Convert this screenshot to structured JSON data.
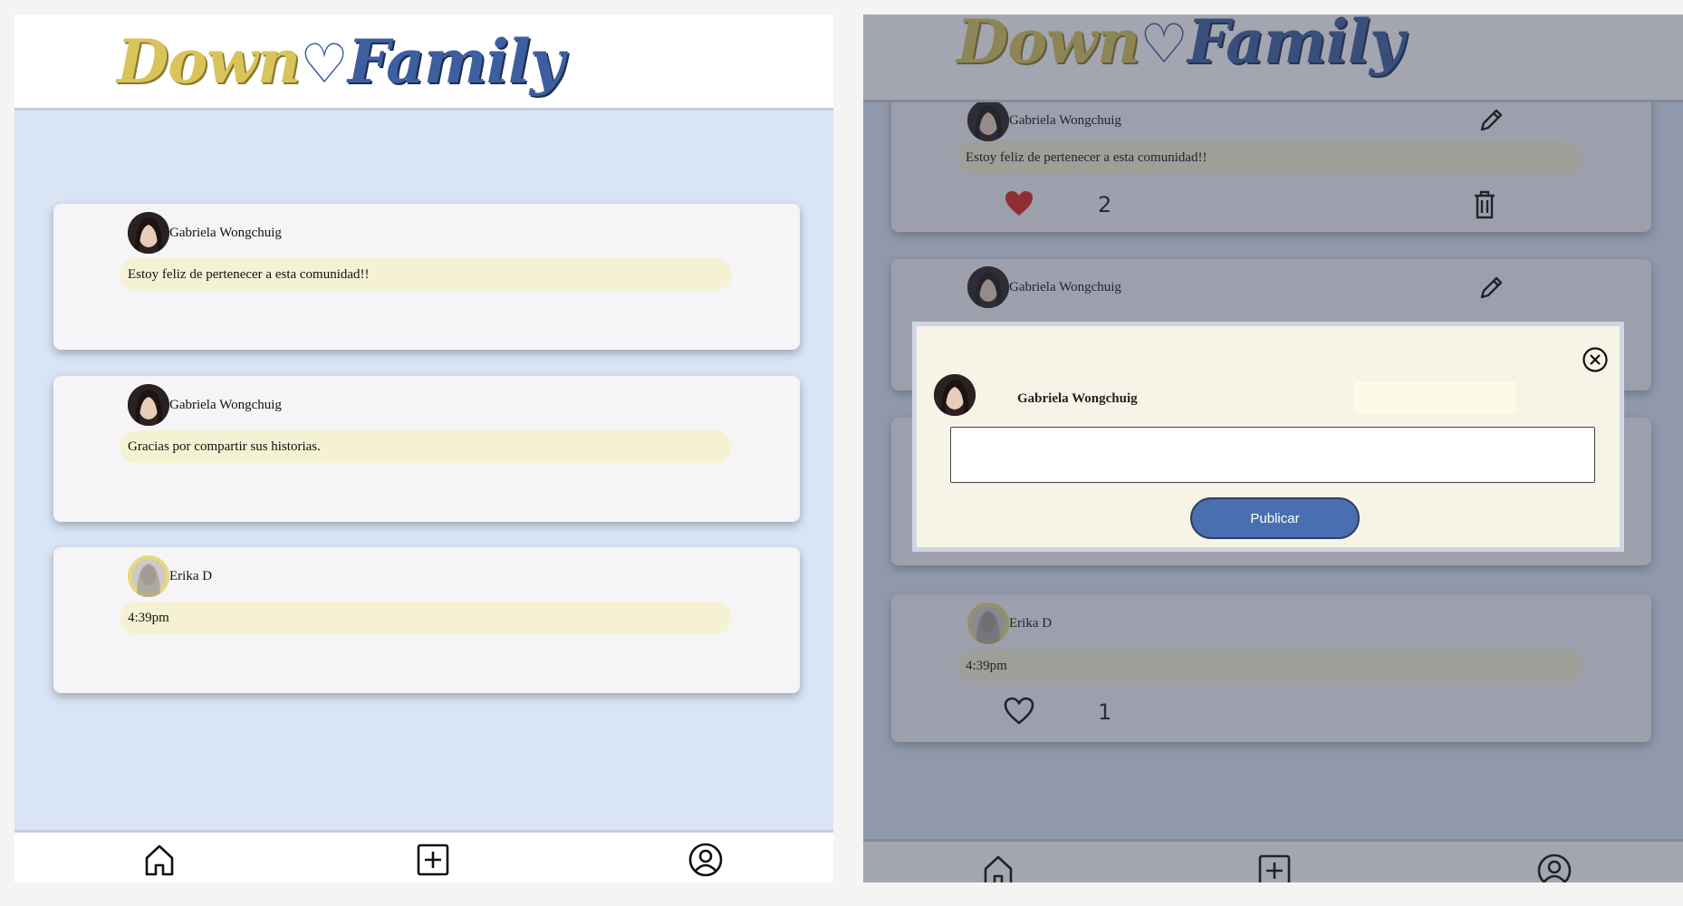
{
  "app": {
    "logo_part1": "Down",
    "logo_heart": "♡",
    "logo_part2": "Family"
  },
  "left_screen": {
    "posts": [
      {
        "author": "Gabriela Wongchuig",
        "text": "Estoy feliz de pertenecer a esta comunidad!!"
      },
      {
        "author": "Gabriela Wongchuig",
        "text": "Gracias por compartir sus historias."
      },
      {
        "author": "Erika D",
        "text": "4:39pm"
      }
    ]
  },
  "right_screen": {
    "posts": [
      {
        "author": "Gabriela Wongchuig",
        "text": "Estoy feliz de pertenecer a esta comunidad!!",
        "likes": "2",
        "liked": true
      },
      {
        "author": "Gabriela Wongchuig"
      },
      {
        "author": "Erika D",
        "text": "4:39pm",
        "likes": "1",
        "liked": false
      }
    ],
    "modal": {
      "author": "Gabriela Wongchuig",
      "textarea_value": "",
      "publish_label": "Publicar"
    }
  },
  "nav": {
    "icons": [
      "home-icon",
      "add-post-icon",
      "profile-icon"
    ]
  },
  "colors": {
    "background": "#d9e4f5",
    "card": "#f5f5f7",
    "bubble": "#f5f2d4",
    "logo_gold": "#d9c45c",
    "logo_blue": "#3e5f9f",
    "publish_button": "#4a6fb0",
    "heart_liked": "#d9261c"
  }
}
